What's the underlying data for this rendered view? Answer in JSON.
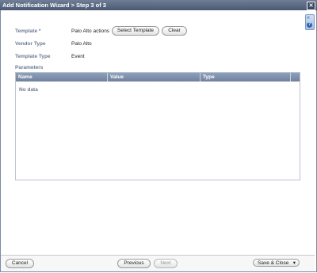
{
  "window": {
    "title": "Add Notification Wizard > Step 3 of 3",
    "close_icon": "✕"
  },
  "side_panel": {
    "collapse_icon": "«",
    "help_icon": "?"
  },
  "form": {
    "template_label": "Template",
    "required_marker": "*",
    "template_value": "Palo Alto actions",
    "select_template_button": "Select Template",
    "clear_button": "Clear",
    "vendor_type_label": "Vendor Type",
    "vendor_type_value": "Palo Alto",
    "template_type_label": "Template Type",
    "template_type_value": "Event",
    "parameters_label": "Parameters"
  },
  "parameters_table": {
    "columns": [
      "Name",
      "Value",
      "Type"
    ],
    "empty_text": "No data"
  },
  "footer": {
    "cancel_button": "Cancel",
    "previous_button": "Previous",
    "next_button": "Next",
    "save_close_button": "Save & Close",
    "save_dropdown_icon": "▾"
  }
}
